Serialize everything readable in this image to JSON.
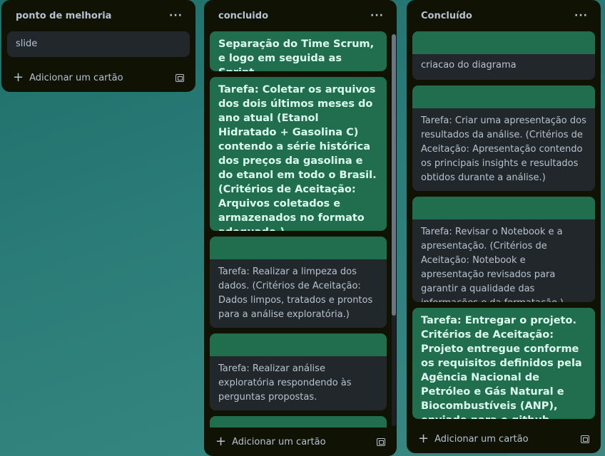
{
  "lists": [
    {
      "title": "ponto de melhoria",
      "menu": "···",
      "cards": [
        {
          "text": "slide"
        }
      ],
      "add_label": "Adicionar um cartão"
    },
    {
      "title": "concluido",
      "menu": "···",
      "cards": [
        {
          "text": "Separação do Time Scrum, e logo em seguida as Sprint.",
          "style": "green"
        },
        {
          "text": "Tarefa: Coletar os arquivos dos dois últimos meses do ano atual (Etanol Hidratado + Gasolina C) contendo a série histórica dos preços da gasolina e do etanol em todo o Brasil. (Critérios de Aceitação: Arquivos coletados e armazenados no formato adequado.)",
          "style": "green"
        },
        {
          "text": "Tarefa: Realizar a limpeza dos dados. (Critérios de Aceitação: Dados limpos, tratados e prontos para a análise exploratória.)",
          "style": "cover"
        },
        {
          "text": "Tarefa: Realizar análise exploratória respondendo às perguntas propostas.",
          "style": "cover"
        }
      ],
      "add_label": "Adicionar um cartão"
    },
    {
      "title": "Concluído",
      "menu": "···",
      "cards": [
        {
          "text": "criacao do diagrama",
          "style": "cover"
        },
        {
          "text": "Tarefa: Criar uma apresentação dos resultados da análise. (Critérios de Aceitação: Apresentação contendo os principais insights e resultados obtidos durante a análise.)",
          "style": "cover"
        },
        {
          "text": "Tarefa: Revisar o Notebook e a apresentação. (Critérios de Aceitação: Notebook e apresentação revisados para garantir a qualidade das informações e da formatação.)",
          "style": "cover"
        },
        {
          "text": "Tarefa: Entregar o projeto. Critérios de Aceitação: Projeto entregue conforme os requisitos definidos pela Agência Nacional de Petróleo e Gás Natural e Biocombustíveis (ANP), enviado para o github",
          "style": "green"
        }
      ],
      "add_label": "Adicionar um cartão"
    }
  ],
  "colors": {
    "list_bg": "#101204",
    "card_bg": "#22272b",
    "green_card": "#216e4e",
    "board_bg": "#2a7c78"
  }
}
